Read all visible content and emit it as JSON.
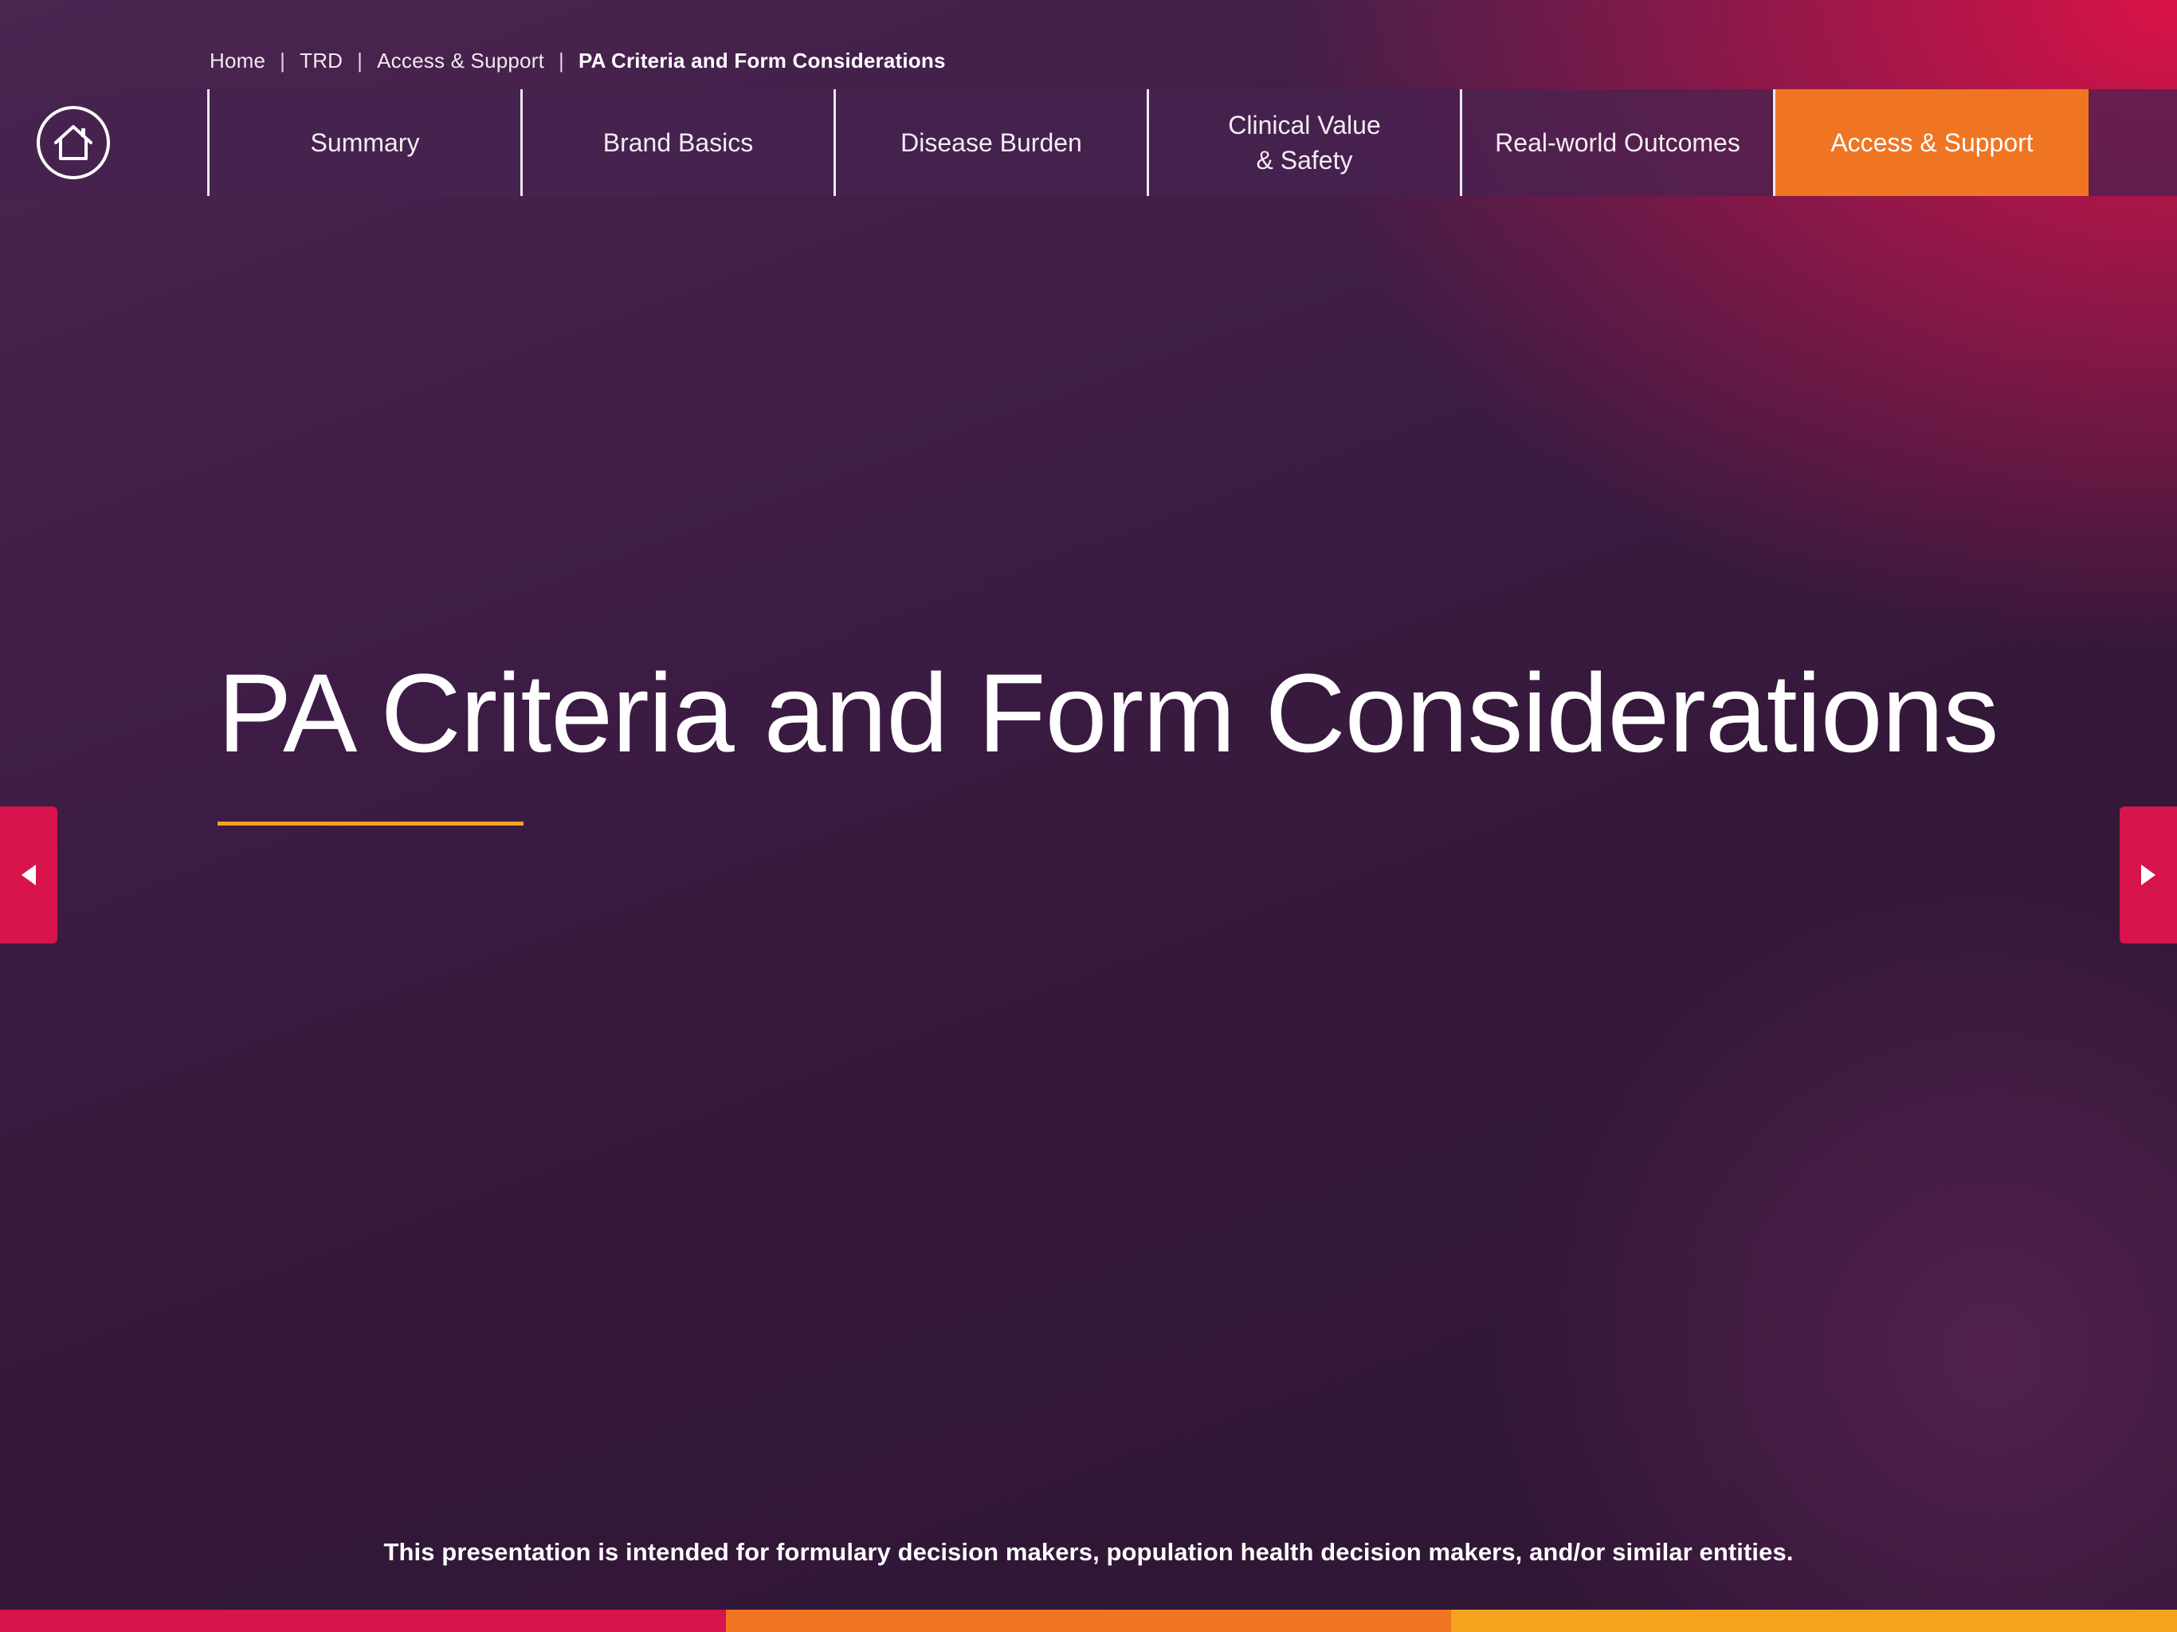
{
  "breadcrumb": {
    "items": [
      "Home",
      "TRD",
      "Access & Support",
      "PA Criteria and Form Considerations"
    ],
    "separator": "|"
  },
  "nav": {
    "home_icon": "home-icon",
    "items": [
      {
        "label": "Summary"
      },
      {
        "label": "Brand Basics"
      },
      {
        "label": "Disease Burden"
      },
      {
        "label_line1": "Clinical Value",
        "label_line2": "& Safety"
      },
      {
        "label": "Real-world Outcomes"
      },
      {
        "label": "Access & Support",
        "active": true
      }
    ]
  },
  "main": {
    "title": "PA Criteria and Form Considerations"
  },
  "navigation": {
    "prev_icon": "triangle-left-icon",
    "next_icon": "triangle-right-icon"
  },
  "footer": {
    "disclaimer": "This presentation is intended for formulary decision makers, population health decision makers, and/or similar entities."
  },
  "colors": {
    "accent_orange": "#f07522",
    "accent_red": "#d7144b",
    "accent_yellow": "#f5a21f",
    "bottom_bar": [
      "#d7144b",
      "#f07522",
      "#f5a21f"
    ]
  }
}
